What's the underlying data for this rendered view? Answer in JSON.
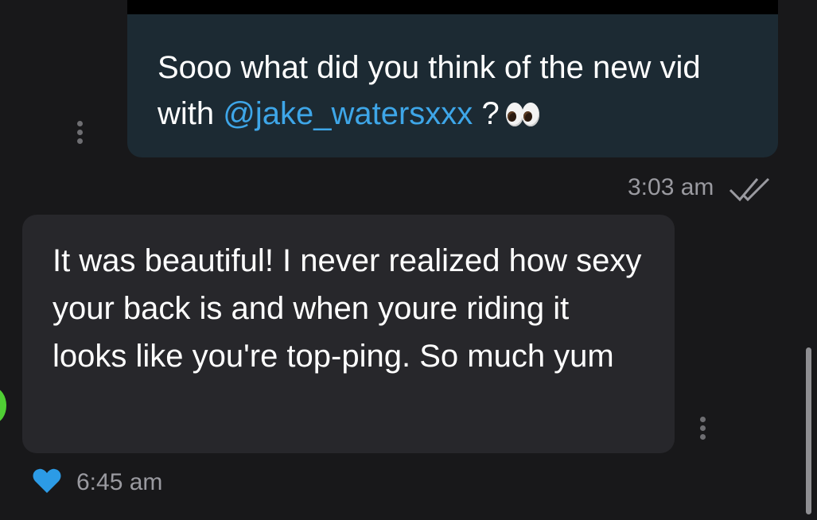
{
  "chat": {
    "outgoing": {
      "text_before": "Sooo what did you think of the new vid with",
      "mention": "@jake_watersxxx",
      "text_after": "?",
      "emoji": "eyes-emoji",
      "time": "3:03 am",
      "status_icon": "double-check-icon"
    },
    "incoming": {
      "text": "It was beautiful! I never realized how sexy your back is and when youre riding it looks like you're top-ping. So much yum",
      "time": "6:45 am",
      "reaction_icon": "heart-icon"
    }
  },
  "colors": {
    "background": "#18181a",
    "outgoing_bubble": "#1c2a33",
    "incoming_bubble": "#27272b",
    "mention": "#3ea6e8",
    "heart": "#2c9be6",
    "timestamp": "#9a9aa0"
  }
}
